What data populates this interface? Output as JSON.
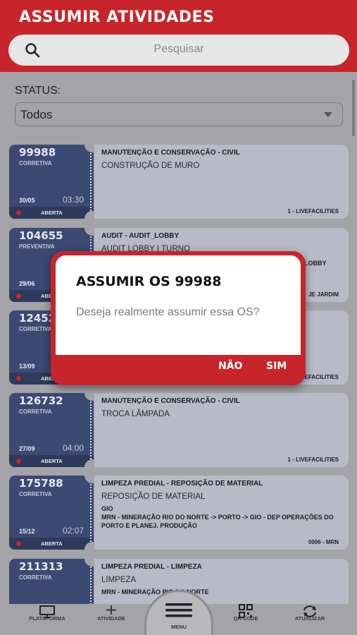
{
  "header": {
    "title": "ASSUMIR ATIVIDADES"
  },
  "search": {
    "placeholder": "Pesquisar",
    "icon": "search-icon"
  },
  "filter": {
    "label": "STATUS:",
    "value": "Todos"
  },
  "cards": [
    {
      "number": "99988",
      "type": "CORRETIVA",
      "date": "30/05",
      "time": "03:30",
      "status": "ABERTA",
      "category": "MANUTENÇÃO E CONSERVAÇÃO - CIVIL",
      "description": "CONSTRUÇÃO DE MURO",
      "extra": "",
      "footer": "1 - LIVEFACILITIES"
    },
    {
      "number": "104655",
      "type": "PREVENTIVA",
      "date": "29/06",
      "time": "",
      "status": "ABERTA",
      "category": "AUDIT - AUDIT_LOBBY",
      "description": "AUDIT LOBBY I TURNO",
      "extra": "",
      "footer": ""
    },
    {
      "number": "124520",
      "type": "CORRETIVA",
      "date": "13/09",
      "time": "",
      "status": "ABERTA",
      "category": "",
      "description": "",
      "extra": "",
      "footer": ""
    },
    {
      "number": "126732",
      "type": "CORRETIVA",
      "date": "27/09",
      "time": "04:00",
      "status": "ABERTA",
      "category": "MANUTENÇÃO E CONSERVAÇÃO - CIVIL",
      "description": "TROCA LÂMPADA",
      "extra": "",
      "footer": "1 - LIVEFACILITIES"
    },
    {
      "number": "175788",
      "type": "CORRETIVA",
      "date": "15/12",
      "time": "02:07",
      "status": "ABERTA",
      "category": "LIMPEZA PREDIAL - REPOSIÇÃO DE MATERIAL",
      "description": "REPOSIÇÃO DE MATERIAL",
      "extra": "GIO\nMRN - MINERAÇÃO RIO DO NORTE -> PORTO -> GIO - DEP OPERAÇÕES DO PORTO E PLANEJ. PRODUÇÃO",
      "footer": "0006 - MRN"
    },
    {
      "number": "211313",
      "type": "CORRETIVA",
      "date": "",
      "time": "",
      "status": "",
      "category": "LIMPEZA PREDIAL - LIMPEZA",
      "description": "LIMPEZA",
      "extra": "MRN - MINERAÇÃO RIO DO NORTE",
      "footer": ""
    }
  ],
  "hidden_fragments": {
    "card2_right_text": "LOBBY",
    "card2_footer": "JE JARDIM",
    "card3_footer": "LIVEFACILITIES"
  },
  "dialog": {
    "title": "ASSUMIR OS 99988",
    "message": "Deseja realmente assumir essa OS?",
    "no_label": "NÃO",
    "yes_label": "SIM"
  },
  "nav": {
    "platform": "PLATAFORMA",
    "activity": "ATIVIDADE",
    "menu": "MENU",
    "qrcode": "QR CODE",
    "refresh": "ATUALIZAR"
  },
  "colors": {
    "brand": "#c8242b",
    "card_left": "#3b4a72",
    "card_right": "#b8bac8"
  }
}
